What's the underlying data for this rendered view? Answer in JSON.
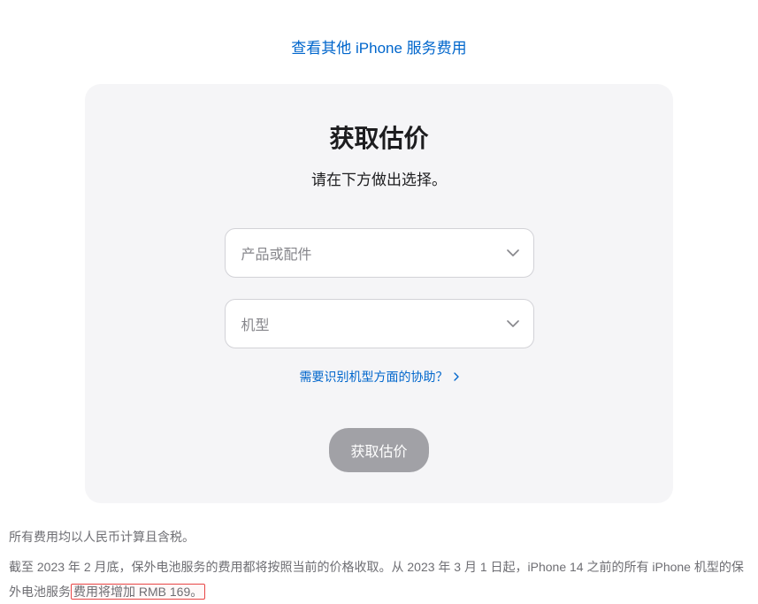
{
  "topLink": {
    "label": "查看其他 iPhone 服务费用"
  },
  "card": {
    "title": "获取估价",
    "subtitle": "请在下方做出选择。",
    "selectProduct": {
      "placeholder": "产品或配件"
    },
    "selectModel": {
      "placeholder": "机型"
    },
    "helpLink": {
      "label": "需要识别机型方面的协助？"
    },
    "submitButton": {
      "label": "获取估价"
    }
  },
  "footer": {
    "line1": "所有费用均以人民币计算且含税。",
    "line2": {
      "prefix": "截至 2023 年 2 月底，保外电池服务的费用都将按照当前的价格收取。从 2023 年 3 月 1 日起，iPhone 14 之前的所有 iPhone 机型的保外电池服务",
      "highlighted": "费用将增加 RMB 169。"
    }
  }
}
